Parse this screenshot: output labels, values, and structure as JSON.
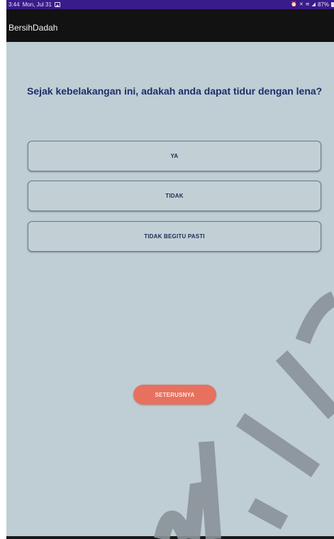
{
  "status_bar": {
    "time": "3:44",
    "date": "Mon, Jul 31",
    "battery": "87%"
  },
  "app_bar": {
    "title": "BersihDadah"
  },
  "question": {
    "text": "Sejak kebelakangan ini, adakah anda dapat tidur dengan lena?"
  },
  "options": [
    {
      "label": "YA"
    },
    {
      "label": "TIDAK"
    },
    {
      "label": "TIDAK BEGITU PASTI"
    }
  ],
  "next_button": {
    "label": "SETERUSNYA"
  },
  "colors": {
    "status_bar": "#3a1b8a",
    "app_bar": "#121212",
    "background": "#bfcdd4",
    "question_text": "#1e2f6a",
    "next_button": "#e8705e"
  },
  "icons": [
    "gallery-icon",
    "alarm-icon",
    "mute-icon",
    "wifi-icon",
    "signal-icon",
    "battery-icon"
  ]
}
